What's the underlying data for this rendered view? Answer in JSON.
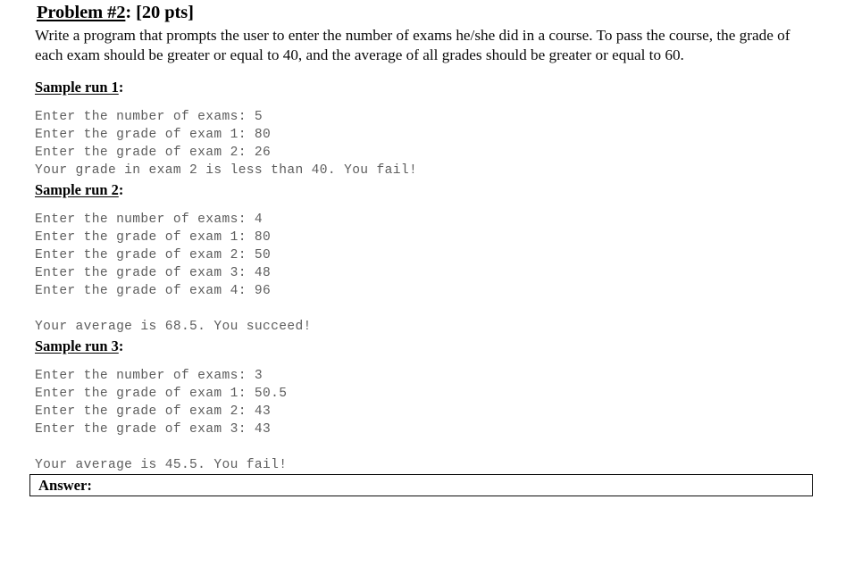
{
  "document": {
    "title_main": "Problem #2",
    "title_rest": ": [20 pts]",
    "description": "Write a program that prompts the user to enter the number of exams he/she did in a course. To pass the course, the grade of each exam should be greater or equal to 40, and the average of all grades should be greater or equal to 60."
  },
  "sample_runs": [
    {
      "heading_main": "Sample run 1",
      "heading_suffix": ":",
      "console": "Enter the number of exams: 5\nEnter the grade of exam 1: 80\nEnter the grade of exam 2: 26\nYour grade in exam 2 is less than 40. You fail!",
      "inputs": {
        "number_of_exams": "5",
        "grades": [
          "80",
          "26"
        ]
      },
      "result": "Your grade in exam 2 is less than 40. You fail!"
    },
    {
      "heading_main": "Sample run 2",
      "heading_suffix": ":",
      "console": "Enter the number of exams: 4\nEnter the grade of exam 1: 80\nEnter the grade of exam 2: 50\nEnter the grade of exam 3: 48\nEnter the grade of exam 4: 96\n\nYour average is 68.5. You succeed!",
      "inputs": {
        "number_of_exams": "4",
        "grades": [
          "80",
          "50",
          "48",
          "96"
        ]
      },
      "result": "Your average is 68.5. You succeed!"
    },
    {
      "heading_main": "Sample run 3",
      "heading_suffix": ":",
      "console": "Enter the number of exams: 3\nEnter the grade of exam 1: 50.5\nEnter the grade of exam 2: 43\nEnter the grade of exam 3: 43\n\nYour average is 45.5. You fail!",
      "inputs": {
        "number_of_exams": "3",
        "grades": [
          "50.5",
          "43",
          "43"
        ]
      },
      "result": "Your average is 45.5. You fail!"
    }
  ],
  "answer": {
    "label": "Answer:",
    "value": ""
  },
  "colors": {
    "page_background": "#ffffff",
    "text": "#000000",
    "console_text": "#5d5d5d",
    "answer_box_border": "#0d0d0d"
  }
}
